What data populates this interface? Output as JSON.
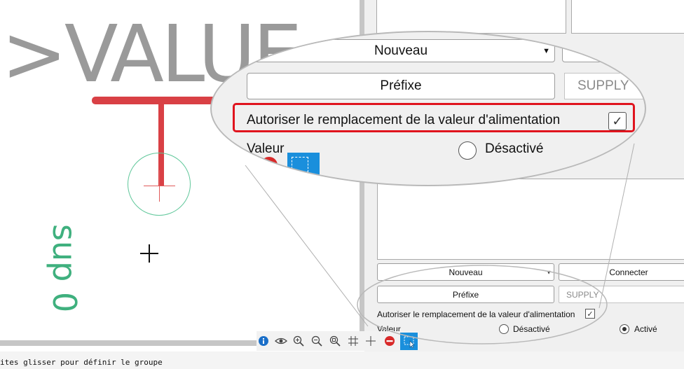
{
  "canvas": {
    "value_text": ">VALUE",
    "supply_text": "sup 0"
  },
  "panel": {
    "combo_value": "Nouveau",
    "connect_label": "Connecter",
    "prefix_label": "Préfixe",
    "supply_placeholder": "SUPPLY",
    "allow_override_label": "Autoriser le remplacement de la valeur d'alimentation",
    "allow_override_checked": true,
    "value_label": "Valeur",
    "option_off": "Désactivé",
    "option_on": "Activé",
    "selected_option": "Activé"
  },
  "toolbar": {
    "icons": [
      "info-icon",
      "eye-icon",
      "zoom-in-icon",
      "zoom-out-icon",
      "zoom-fit-icon",
      "grid-icon",
      "crosshair-icon",
      "stop-icon",
      "select-icon"
    ]
  },
  "status": {
    "text": "ites glisser pour définir le groupe"
  },
  "colors": {
    "wire": "#d94045",
    "pin": "#5fc79a",
    "label_gray": "#9a9a9a",
    "supply_green": "#3fb07e",
    "highlight": "#e0141e",
    "select_blue": "#1a8fdc"
  }
}
